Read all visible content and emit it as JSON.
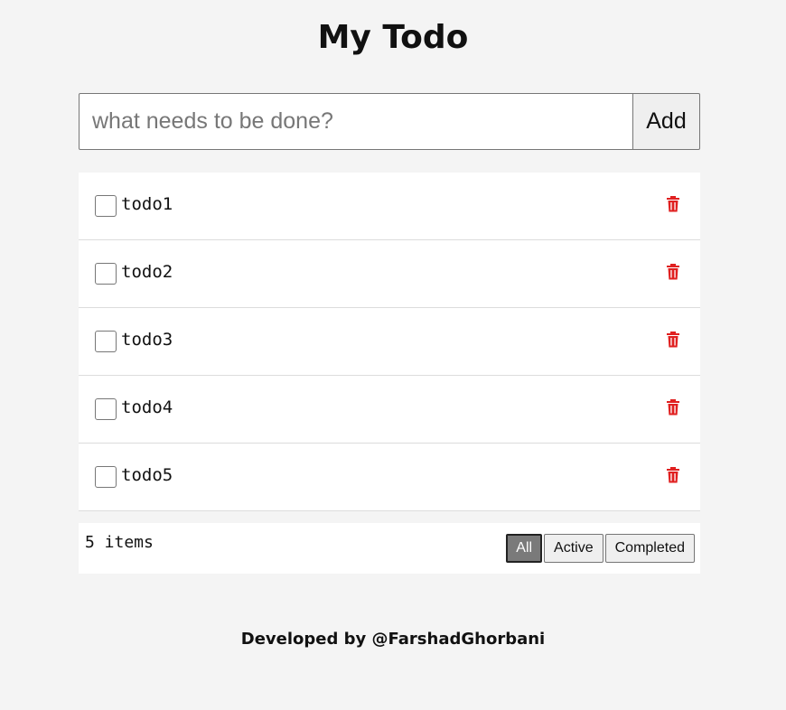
{
  "header": {
    "title": "My Todo"
  },
  "add_form": {
    "placeholder": "what needs to be done?",
    "value": "",
    "add_label": "Add"
  },
  "todos": [
    {
      "text": "todo1",
      "completed": false
    },
    {
      "text": "todo2",
      "completed": false
    },
    {
      "text": "todo3",
      "completed": false
    },
    {
      "text": "todo4",
      "completed": false
    },
    {
      "text": "todo5",
      "completed": false
    }
  ],
  "footer": {
    "items_count": "5 items",
    "filters": [
      {
        "label": "All",
        "selected": true
      },
      {
        "label": "Active",
        "selected": false
      },
      {
        "label": "Completed",
        "selected": false
      }
    ]
  },
  "credit": "Developed by @FarshadGhorbani",
  "colors": {
    "delete_icon": "#e02020",
    "background": "#f4f4f4",
    "selected_filter": "#7a7a7a"
  },
  "icons": {
    "delete": "trash-icon"
  }
}
